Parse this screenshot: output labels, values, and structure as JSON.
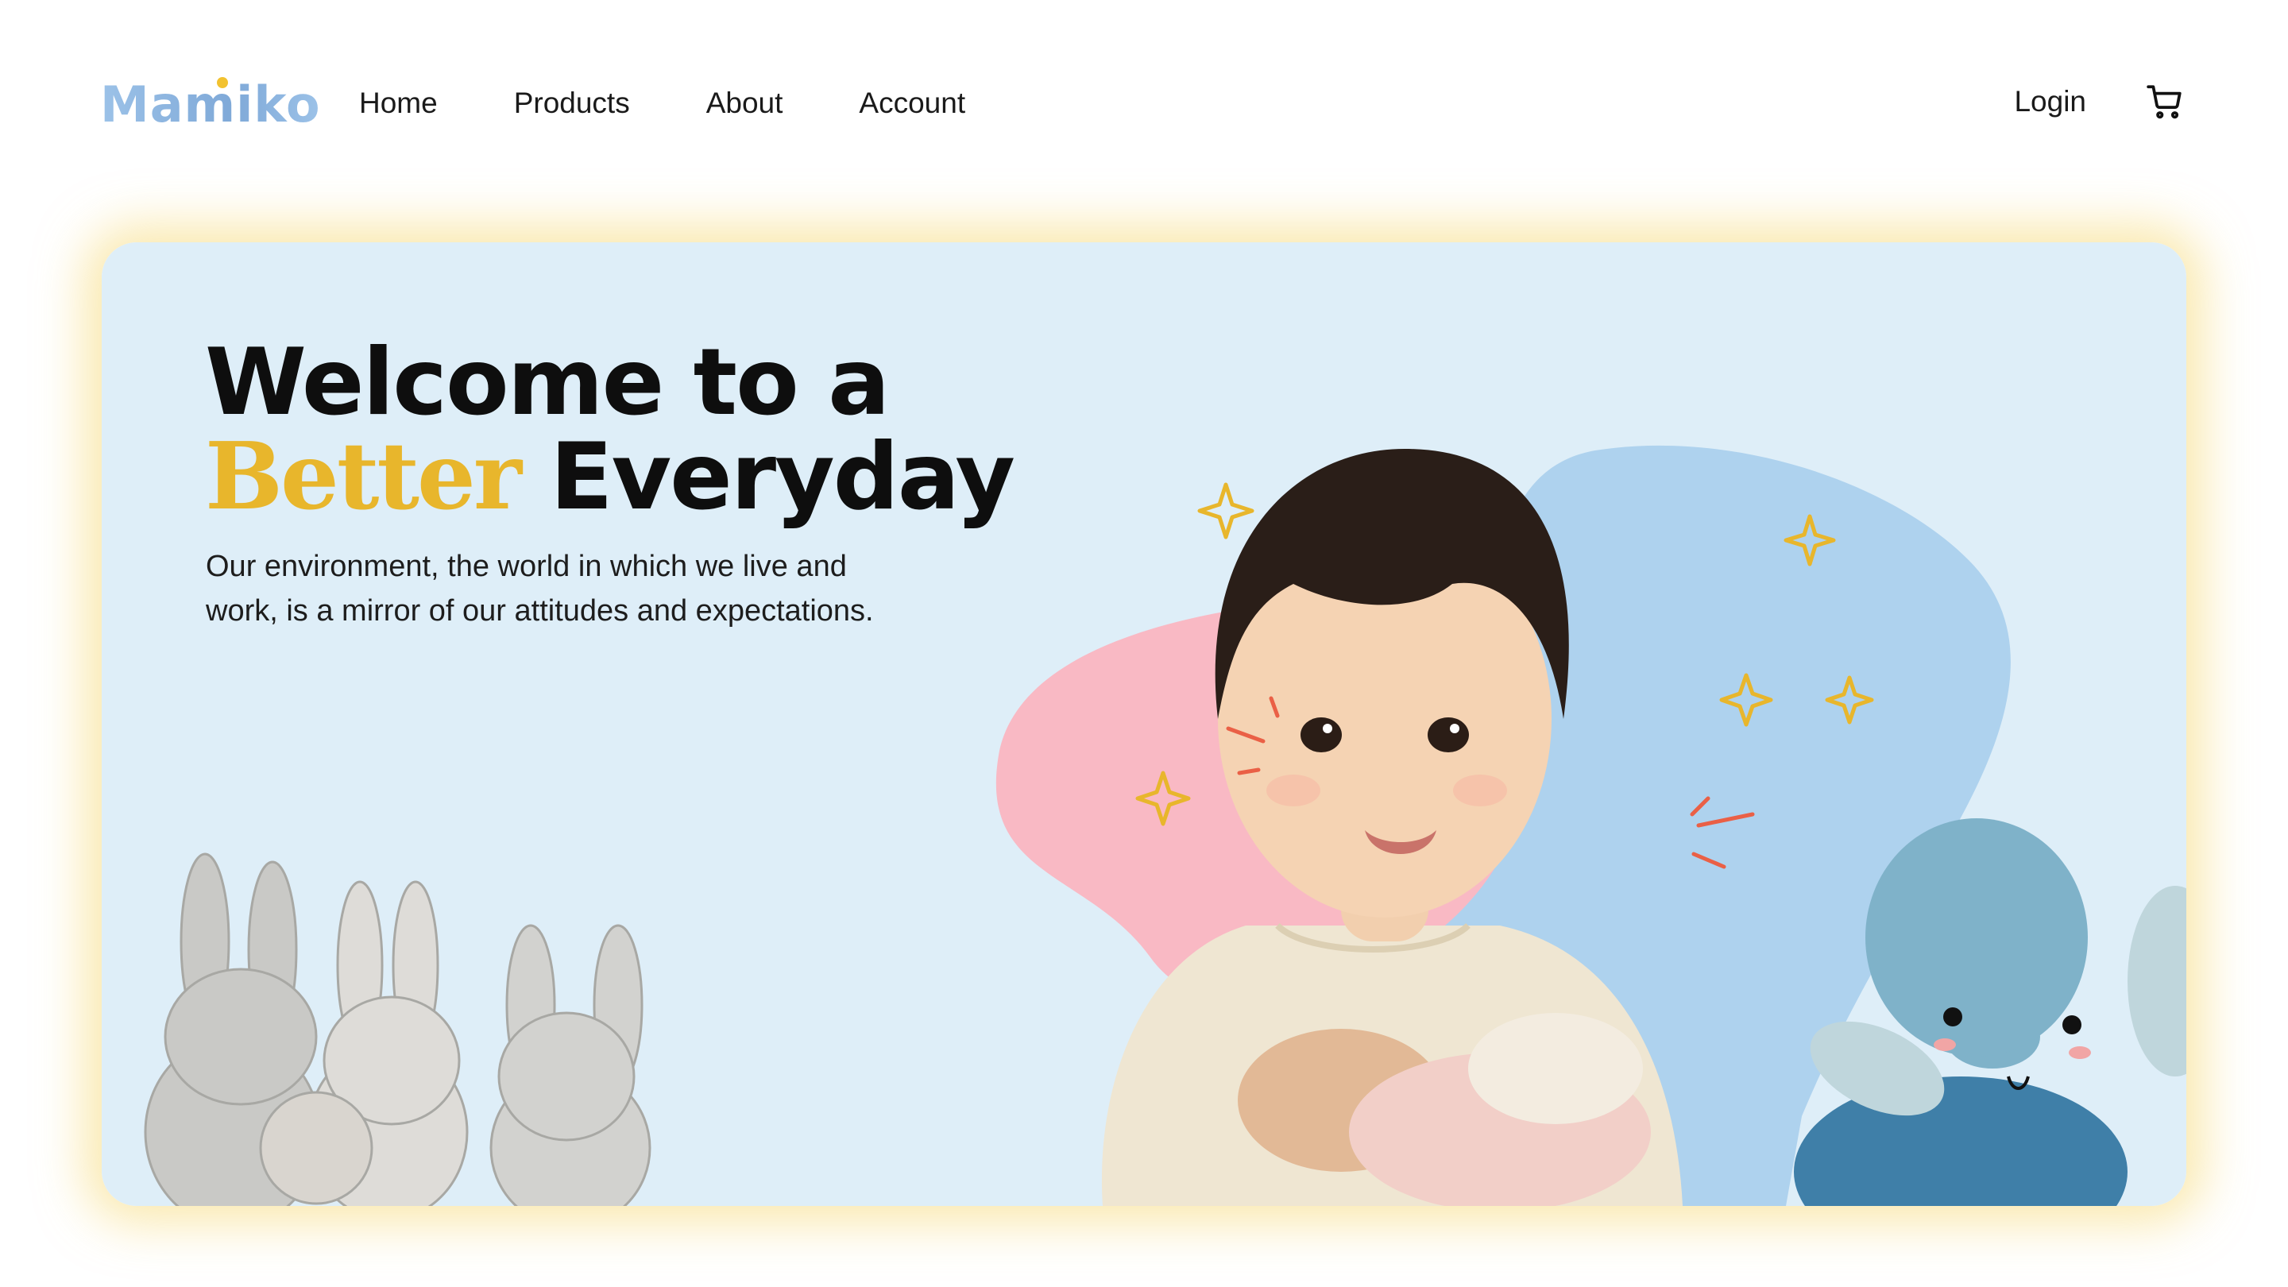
{
  "brand": {
    "logo_text": "Mamiko"
  },
  "nav": {
    "links": [
      "Home",
      "Products",
      "About",
      "Account"
    ],
    "login_label": "Login"
  },
  "hero": {
    "headline_line1": "Welcome to a",
    "headline_accent": "Better",
    "headline_rest": "Everyday",
    "subtext": "Our environment, the world in which we live and work, is a mirror of our attitudes and expectations."
  },
  "icons": {
    "cart": "cart-icon"
  },
  "colors": {
    "accent_yellow": "#e8b62c",
    "hero_bg": "#deeef8",
    "blob_pink": "#f9b9c4",
    "blob_blue": "#aed2ee",
    "glow": "#f5d76e"
  }
}
